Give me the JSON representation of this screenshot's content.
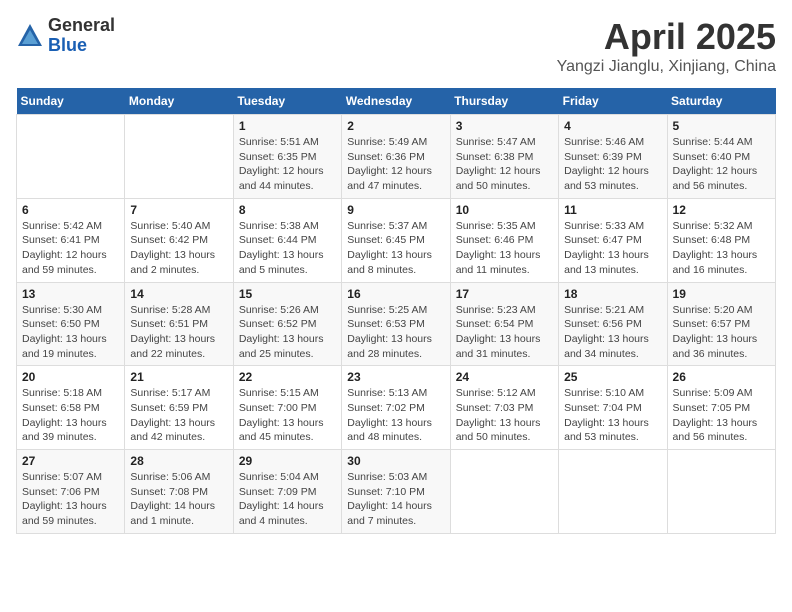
{
  "header": {
    "logo_general": "General",
    "logo_blue": "Blue",
    "title": "April 2025",
    "subtitle": "Yangzi Jianglu, Xinjiang, China"
  },
  "days_of_week": [
    "Sunday",
    "Monday",
    "Tuesday",
    "Wednesday",
    "Thursday",
    "Friday",
    "Saturday"
  ],
  "weeks": [
    [
      {
        "day": "",
        "info": ""
      },
      {
        "day": "",
        "info": ""
      },
      {
        "day": "1",
        "info": "Sunrise: 5:51 AM\nSunset: 6:35 PM\nDaylight: 12 hours and 44 minutes."
      },
      {
        "day": "2",
        "info": "Sunrise: 5:49 AM\nSunset: 6:36 PM\nDaylight: 12 hours and 47 minutes."
      },
      {
        "day": "3",
        "info": "Sunrise: 5:47 AM\nSunset: 6:38 PM\nDaylight: 12 hours and 50 minutes."
      },
      {
        "day": "4",
        "info": "Sunrise: 5:46 AM\nSunset: 6:39 PM\nDaylight: 12 hours and 53 minutes."
      },
      {
        "day": "5",
        "info": "Sunrise: 5:44 AM\nSunset: 6:40 PM\nDaylight: 12 hours and 56 minutes."
      }
    ],
    [
      {
        "day": "6",
        "info": "Sunrise: 5:42 AM\nSunset: 6:41 PM\nDaylight: 12 hours and 59 minutes."
      },
      {
        "day": "7",
        "info": "Sunrise: 5:40 AM\nSunset: 6:42 PM\nDaylight: 13 hours and 2 minutes."
      },
      {
        "day": "8",
        "info": "Sunrise: 5:38 AM\nSunset: 6:44 PM\nDaylight: 13 hours and 5 minutes."
      },
      {
        "day": "9",
        "info": "Sunrise: 5:37 AM\nSunset: 6:45 PM\nDaylight: 13 hours and 8 minutes."
      },
      {
        "day": "10",
        "info": "Sunrise: 5:35 AM\nSunset: 6:46 PM\nDaylight: 13 hours and 11 minutes."
      },
      {
        "day": "11",
        "info": "Sunrise: 5:33 AM\nSunset: 6:47 PM\nDaylight: 13 hours and 13 minutes."
      },
      {
        "day": "12",
        "info": "Sunrise: 5:32 AM\nSunset: 6:48 PM\nDaylight: 13 hours and 16 minutes."
      }
    ],
    [
      {
        "day": "13",
        "info": "Sunrise: 5:30 AM\nSunset: 6:50 PM\nDaylight: 13 hours and 19 minutes."
      },
      {
        "day": "14",
        "info": "Sunrise: 5:28 AM\nSunset: 6:51 PM\nDaylight: 13 hours and 22 minutes."
      },
      {
        "day": "15",
        "info": "Sunrise: 5:26 AM\nSunset: 6:52 PM\nDaylight: 13 hours and 25 minutes."
      },
      {
        "day": "16",
        "info": "Sunrise: 5:25 AM\nSunset: 6:53 PM\nDaylight: 13 hours and 28 minutes."
      },
      {
        "day": "17",
        "info": "Sunrise: 5:23 AM\nSunset: 6:54 PM\nDaylight: 13 hours and 31 minutes."
      },
      {
        "day": "18",
        "info": "Sunrise: 5:21 AM\nSunset: 6:56 PM\nDaylight: 13 hours and 34 minutes."
      },
      {
        "day": "19",
        "info": "Sunrise: 5:20 AM\nSunset: 6:57 PM\nDaylight: 13 hours and 36 minutes."
      }
    ],
    [
      {
        "day": "20",
        "info": "Sunrise: 5:18 AM\nSunset: 6:58 PM\nDaylight: 13 hours and 39 minutes."
      },
      {
        "day": "21",
        "info": "Sunrise: 5:17 AM\nSunset: 6:59 PM\nDaylight: 13 hours and 42 minutes."
      },
      {
        "day": "22",
        "info": "Sunrise: 5:15 AM\nSunset: 7:00 PM\nDaylight: 13 hours and 45 minutes."
      },
      {
        "day": "23",
        "info": "Sunrise: 5:13 AM\nSunset: 7:02 PM\nDaylight: 13 hours and 48 minutes."
      },
      {
        "day": "24",
        "info": "Sunrise: 5:12 AM\nSunset: 7:03 PM\nDaylight: 13 hours and 50 minutes."
      },
      {
        "day": "25",
        "info": "Sunrise: 5:10 AM\nSunset: 7:04 PM\nDaylight: 13 hours and 53 minutes."
      },
      {
        "day": "26",
        "info": "Sunrise: 5:09 AM\nSunset: 7:05 PM\nDaylight: 13 hours and 56 minutes."
      }
    ],
    [
      {
        "day": "27",
        "info": "Sunrise: 5:07 AM\nSunset: 7:06 PM\nDaylight: 13 hours and 59 minutes."
      },
      {
        "day": "28",
        "info": "Sunrise: 5:06 AM\nSunset: 7:08 PM\nDaylight: 14 hours and 1 minute."
      },
      {
        "day": "29",
        "info": "Sunrise: 5:04 AM\nSunset: 7:09 PM\nDaylight: 14 hours and 4 minutes."
      },
      {
        "day": "30",
        "info": "Sunrise: 5:03 AM\nSunset: 7:10 PM\nDaylight: 14 hours and 7 minutes."
      },
      {
        "day": "",
        "info": ""
      },
      {
        "day": "",
        "info": ""
      },
      {
        "day": "",
        "info": ""
      }
    ]
  ]
}
